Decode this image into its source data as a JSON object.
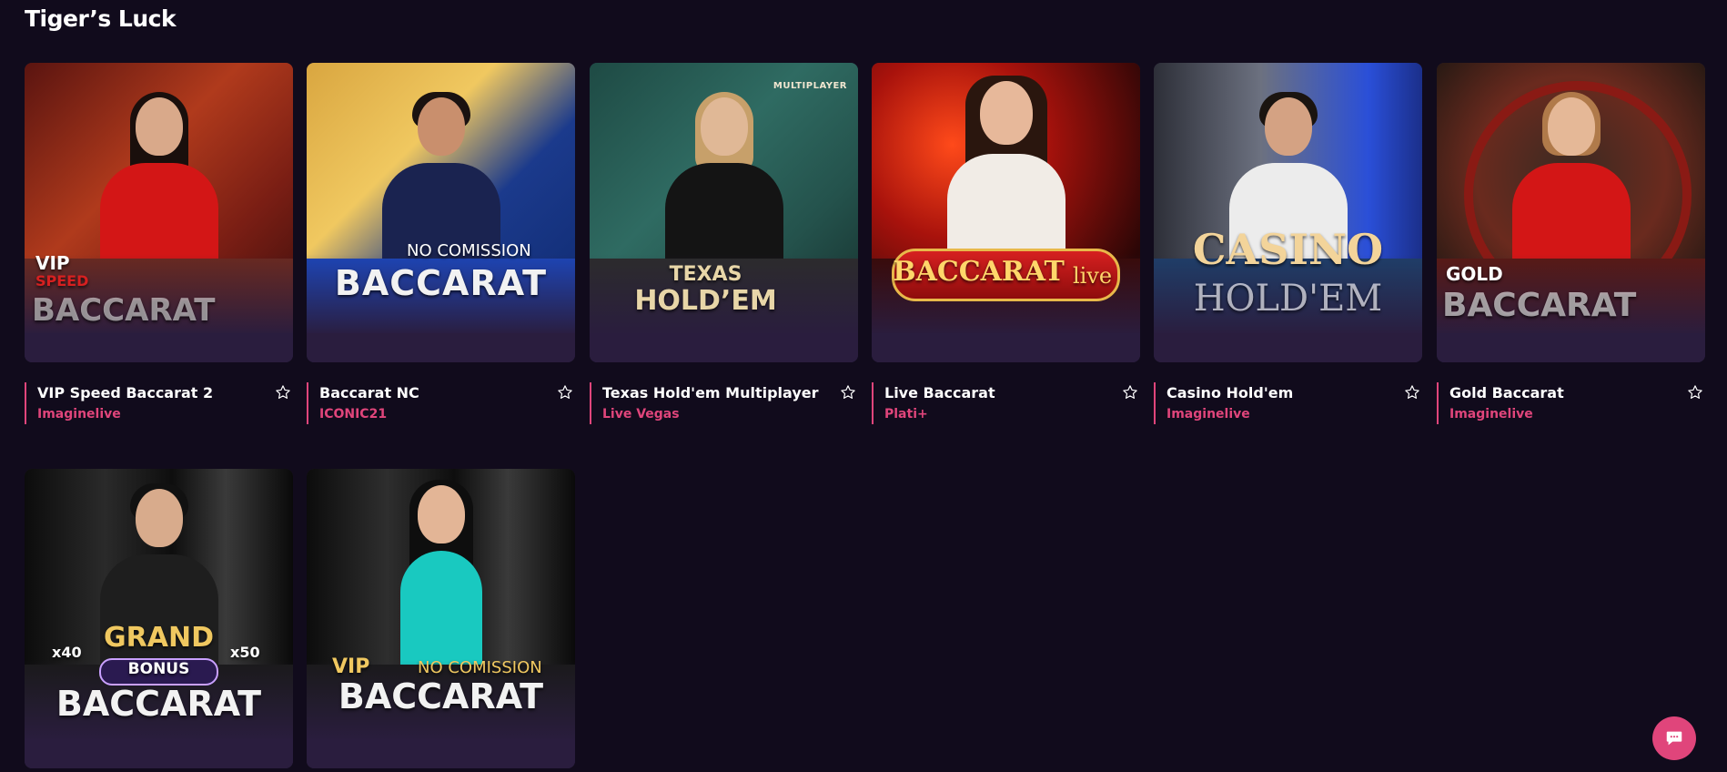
{
  "section": {
    "title": "Tiger’s Luck"
  },
  "games": [
    {
      "title": "VIP Speed Baccarat 2",
      "provider": "Imaginelive",
      "logo_top": "VIP",
      "logo_mid": "SPEED",
      "logo_main": "BACCARAT"
    },
    {
      "title": "Baccarat NC",
      "provider": "ICONIC21",
      "logo_top": "NO COMISSION",
      "logo_main": "BACCARAT"
    },
    {
      "title": "Texas Hold'em Multiplayer",
      "provider": "Live Vegas",
      "badge": "MULTIPLAYER",
      "logo_top": "TEXAS",
      "logo_main": "HOLD’EM"
    },
    {
      "title": "Live Baccarat",
      "provider": "Plati+",
      "logo_main": "BACCARAT",
      "logo_suffix": "live"
    },
    {
      "title": "Casino Hold'em",
      "provider": "Imaginelive",
      "logo_top": "CASINO",
      "logo_main": "HOLD'EM"
    },
    {
      "title": "Gold Baccarat",
      "provider": "Imaginelive",
      "logo_top": "GOLD",
      "logo_main": "BACCARAT"
    },
    {
      "title": "",
      "provider": "",
      "logo_top": "GRAND",
      "logo_mid": "BONUS",
      "logo_main": "BACCARAT",
      "mult_left": "x40",
      "mult_right": "x50"
    },
    {
      "title": "",
      "provider": "",
      "logo_top": "NO COMISSION",
      "logo_pre": "VIP",
      "logo_main": "BACCARAT"
    }
  ],
  "icons": {
    "favorite": "star-outline-icon",
    "chat": "chat-bubble-icon"
  },
  "colors": {
    "background": "#110b1c",
    "accent": "#e0457b",
    "card": "#2a1d3e"
  }
}
